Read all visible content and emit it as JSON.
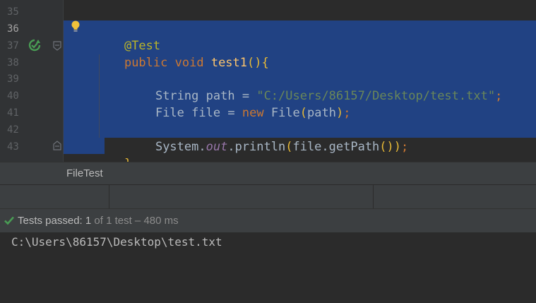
{
  "editor": {
    "line_numbers": [
      "35",
      "36",
      "37",
      "38",
      "39",
      "40",
      "41",
      "42",
      "43"
    ],
    "lines": {
      "annotation": "@Test",
      "l37": {
        "kw1": "public",
        "kw2": "void",
        "method": "test1",
        "parens": "()",
        "brace": "{"
      },
      "l39": {
        "type": "String",
        "var": "path",
        "eq": "=",
        "value": "\"C:/Users/86157/Desktop/test.txt\"",
        "semi": ";"
      },
      "l40": {
        "type": "File",
        "var": "file",
        "eq": "=",
        "kw": "new",
        "ctor": "File",
        "open": "(",
        "arg": "path",
        "close": ")",
        "semi": ";"
      },
      "l42": {
        "obj": "System.",
        "field": "out",
        "call": ".println",
        "open": "(",
        "arg": "file.getPath",
        "inner": "()",
        "close": ")",
        "semi": ";"
      },
      "l43": {
        "brace": "}"
      }
    }
  },
  "tab": {
    "label": "FileTest"
  },
  "status": {
    "prefix": "Tests passed: ",
    "count": "1",
    "rest": " of 1 test – 480 ms"
  },
  "console": {
    "output": "C:\\Users\\86157\\Desktop\\test.txt"
  },
  "colors": {
    "selection": "#214283",
    "keyword": "#cc7832",
    "string": "#6a8759",
    "pass": "#499c54"
  },
  "icons": [
    "lightbulb-icon",
    "run-test-icon",
    "fold-icon",
    "check-icon"
  ]
}
